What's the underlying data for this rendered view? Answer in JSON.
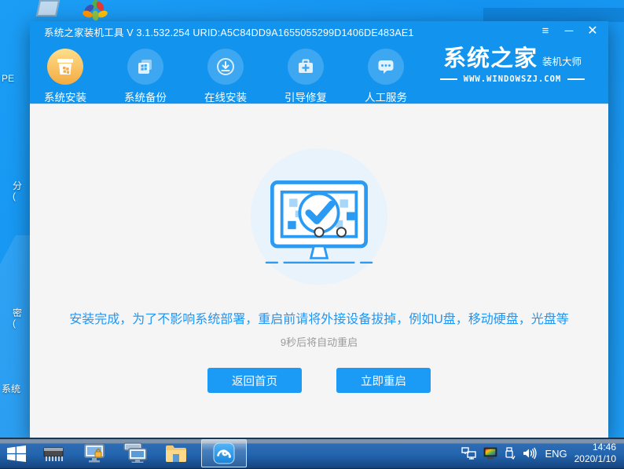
{
  "colors": {
    "desktop_blue": "#1596F3",
    "window_blue": "#1193EE",
    "active_orange": "#F3AB42",
    "accent_blue": "#2196F3",
    "button_blue": "#1B9AF6",
    "content_bg": "#F5F5F6",
    "gray_text": "#9B9B9B"
  },
  "window": {
    "title": "系统之家装机工具 V 3.1.532.254 URID:A5C84DD9A1655055299D1406DE483AE1",
    "controls": {
      "menu": "≡",
      "minimize": "─",
      "close": "✕"
    }
  },
  "nav": {
    "items": [
      {
        "label": "系统安装",
        "icon": "install-box-icon",
        "active": true
      },
      {
        "label": "系统备份",
        "icon": "backup-copies-icon",
        "active": false
      },
      {
        "label": "在线安装",
        "icon": "download-circle-icon",
        "active": false
      },
      {
        "label": "引导修复",
        "icon": "toolbox-icon",
        "active": false
      },
      {
        "label": "人工服务",
        "icon": "chat-bubble-icon",
        "active": false
      }
    ]
  },
  "logo": {
    "brand": "系统之家",
    "subtitle": "装机大师",
    "url": "WWW.WINDOWSZJ.COM"
  },
  "main": {
    "illustration": "monitor-checkmark-illustration",
    "message": "安装完成，为了不影响系统部署，重启前请将外接设备拔掉，例如U盘，移动硬盘，光盘等",
    "countdown": "9秒后将自动重启",
    "buttons": [
      {
        "label": "返回首页"
      },
      {
        "label": "立即重启"
      }
    ]
  },
  "taskbar": {
    "icons": [
      "start-icon",
      "chip-icon",
      "screen-lock-icon",
      "remote-desktop-icon",
      "folder-icon",
      "app-swoosh-icon"
    ],
    "tray": {
      "language": "ENG",
      "time": "14:46",
      "date": "2020/1/10"
    }
  },
  "desktop": {
    "fragments": [
      {
        "text": "PE"
      },
      {
        "text": "分"
      },
      {
        "text": "("
      },
      {
        "text": "密"
      },
      {
        "text": "("
      },
      {
        "text": "系统"
      }
    ]
  }
}
